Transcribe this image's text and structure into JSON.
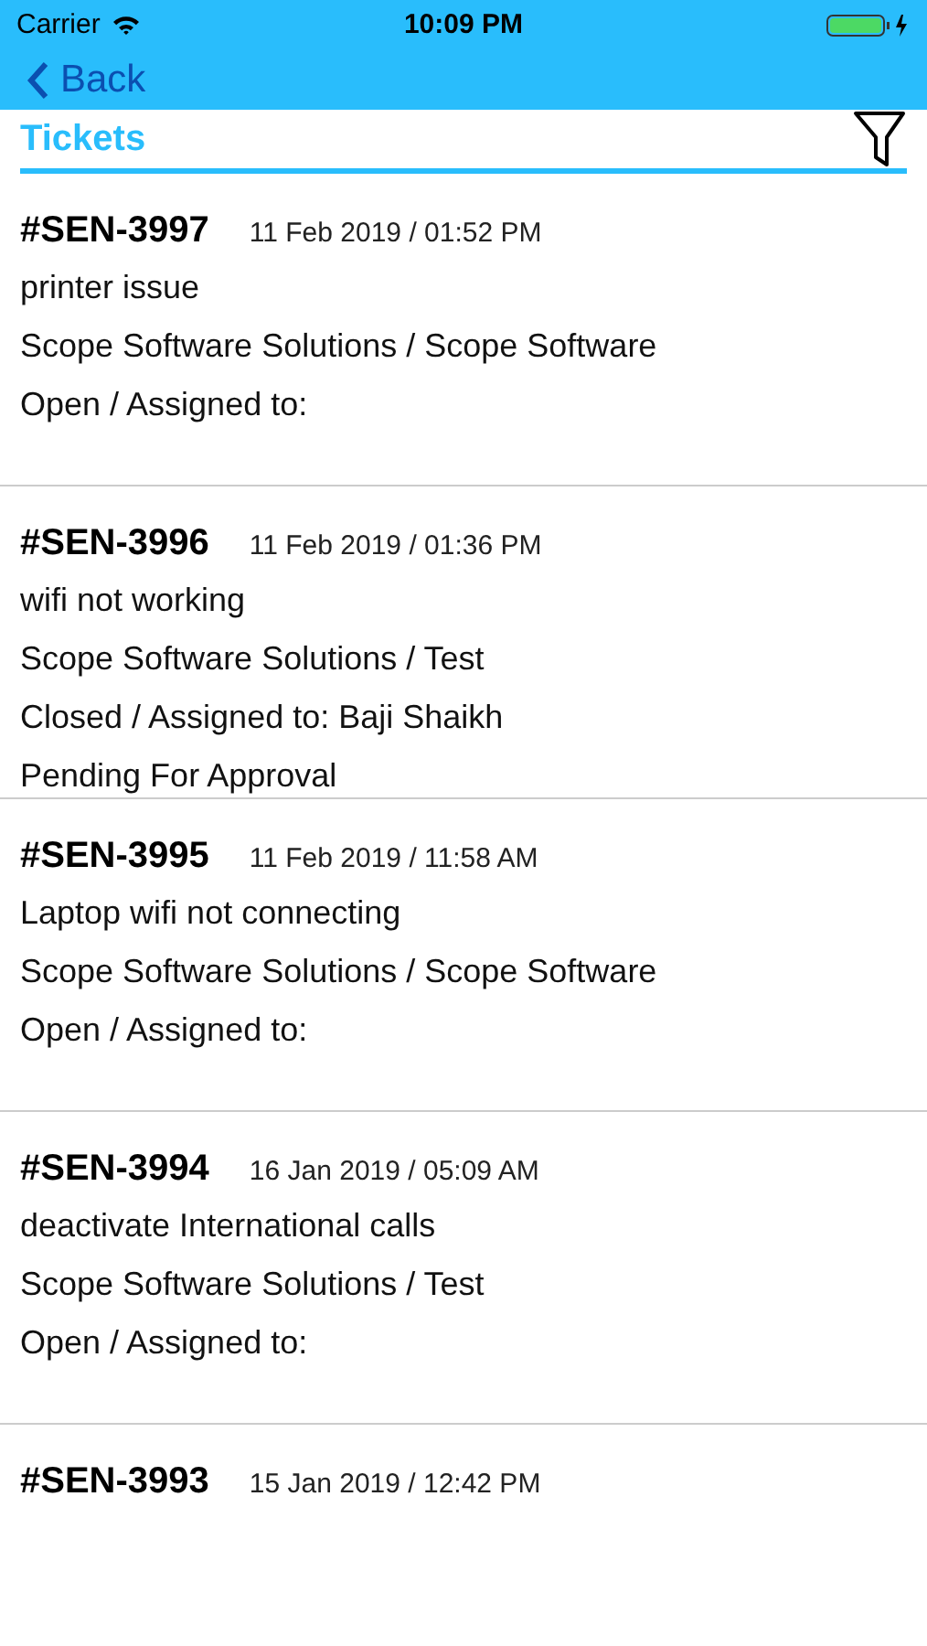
{
  "status_bar": {
    "carrier": "Carrier",
    "time": "10:09 PM"
  },
  "nav": {
    "back": "Back"
  },
  "header": {
    "title": "Tickets"
  },
  "tickets": [
    {
      "id": "#SEN-3997",
      "date": "11 Feb 2019 / 01:52 PM",
      "lines": [
        "printer issue",
        "Scope Software Solutions / Scope Software",
        "Open / Assigned to:"
      ]
    },
    {
      "id": "#SEN-3996",
      "date": "11 Feb 2019 / 01:36 PM",
      "lines": [
        "wifi not working",
        "Scope Software Solutions / Test",
        "Closed / Assigned to: Baji Shaikh",
        "Pending For Approval"
      ]
    },
    {
      "id": "#SEN-3995",
      "date": "11 Feb 2019 / 11:58 AM",
      "lines": [
        "Laptop wifi not connecting",
        "Scope Software Solutions / Scope Software",
        "Open / Assigned to:"
      ]
    },
    {
      "id": "#SEN-3994",
      "date": "16 Jan 2019 / 05:09 AM",
      "lines": [
        "deactivate International calls",
        "Scope Software Solutions / Test",
        "Open / Assigned to:"
      ]
    },
    {
      "id": "#SEN-3993",
      "date": "15 Jan 2019 / 12:42 PM"
    }
  ]
}
